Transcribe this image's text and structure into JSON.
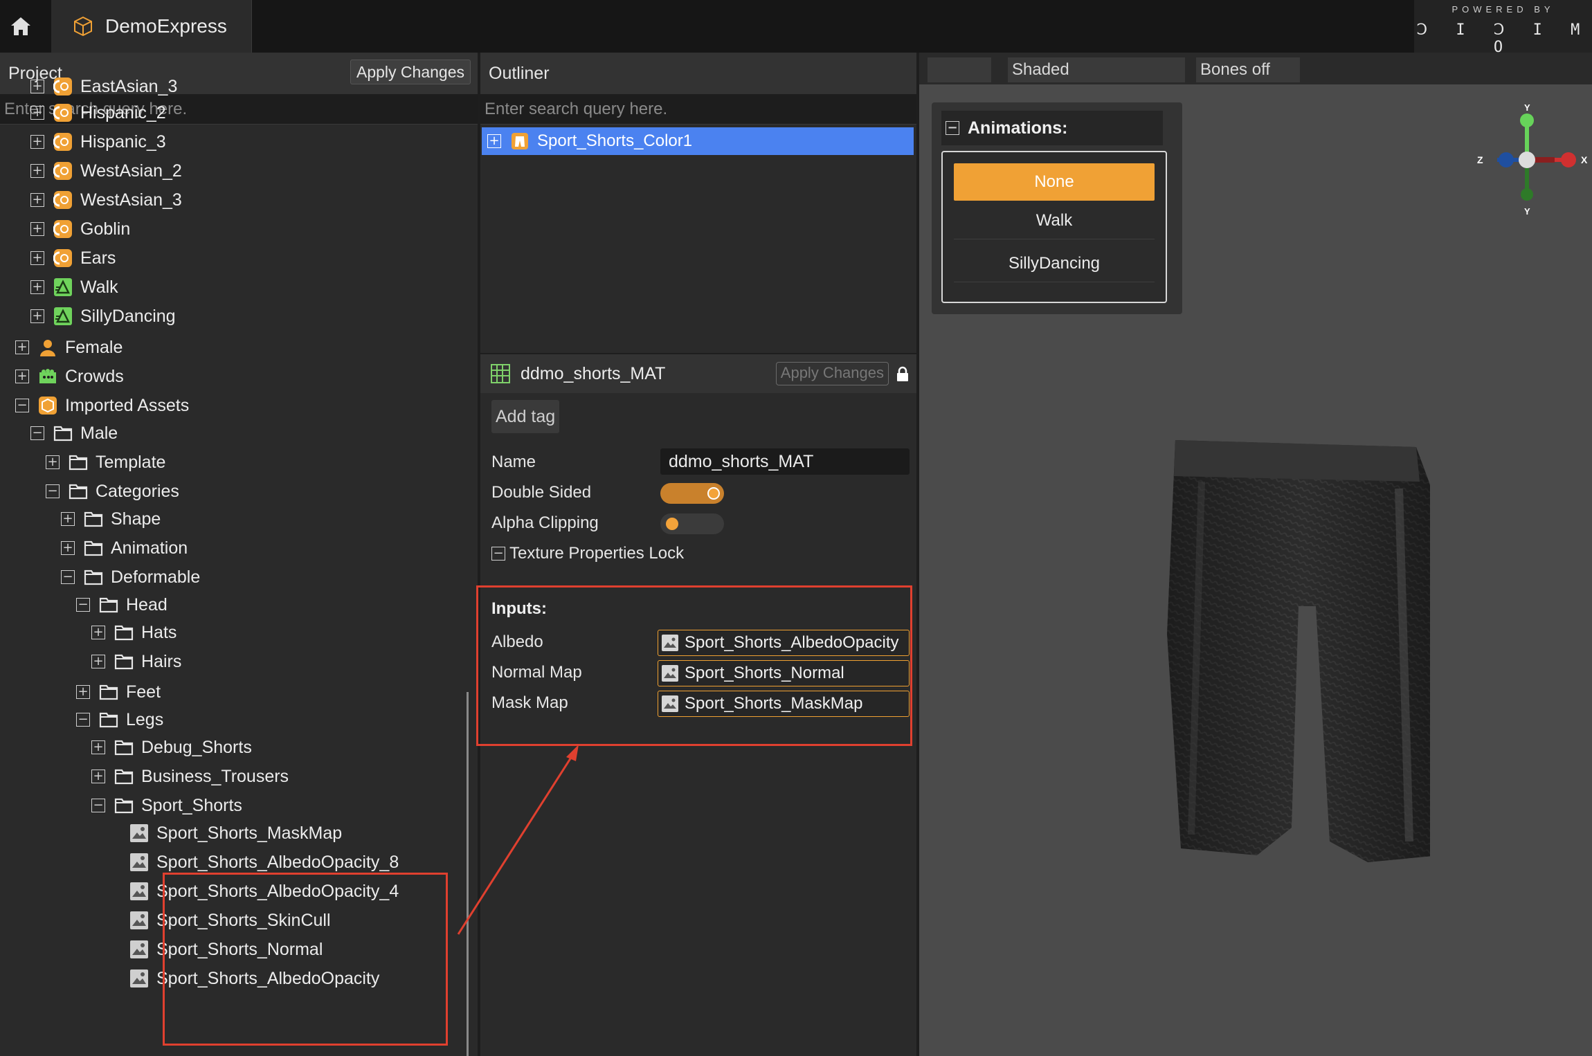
{
  "topbar": {
    "app_name": "DemoExpress",
    "powered_by": "POWERED BY",
    "brand": "DIDIMO"
  },
  "project": {
    "title": "Project",
    "apply_changes": "Apply Changes",
    "search_placeholder": "Enter search query here.",
    "tree": [
      {
        "label": "EastAsian_3",
        "icon": "face-icon",
        "expanded": false
      },
      {
        "label": "Hispanic_2",
        "icon": "face-icon",
        "expanded": false
      },
      {
        "label": "Hispanic_3",
        "icon": "face-icon",
        "expanded": false
      },
      {
        "label": "WestAsian_2",
        "icon": "face-icon",
        "expanded": false
      },
      {
        "label": "WestAsian_3",
        "icon": "face-icon",
        "expanded": false
      },
      {
        "label": "Goblin",
        "icon": "face-icon",
        "expanded": false
      },
      {
        "label": "Ears",
        "icon": "face-icon",
        "expanded": false
      },
      {
        "label": "Walk",
        "icon": "animation-icon",
        "expanded": false
      },
      {
        "label": "SillyDancing",
        "icon": "animation-icon",
        "expanded": false
      },
      {
        "label": "Female",
        "icon": "person-icon",
        "expanded": false
      },
      {
        "label": "Crowds",
        "icon": "crowd-icon",
        "expanded": false
      },
      {
        "label": "Imported Assets",
        "icon": "package-icon",
        "expanded": true
      },
      {
        "label": "Male",
        "icon": "folder-icon",
        "expanded": true
      },
      {
        "label": "Template",
        "icon": "folder-icon",
        "expanded": false
      },
      {
        "label": "Categories",
        "icon": "folder-icon",
        "expanded": true
      },
      {
        "label": "Shape",
        "icon": "folder-icon",
        "expanded": false
      },
      {
        "label": "Animation",
        "icon": "folder-icon",
        "expanded": false
      },
      {
        "label": "Deformable",
        "icon": "folder-icon",
        "expanded": true
      },
      {
        "label": "Head",
        "icon": "folder-icon",
        "expanded": true
      },
      {
        "label": "Hats",
        "icon": "folder-icon",
        "expanded": false
      },
      {
        "label": "Hairs",
        "icon": "folder-icon",
        "expanded": false
      },
      {
        "label": "Feet",
        "icon": "folder-icon",
        "expanded": false
      },
      {
        "label": "Legs",
        "icon": "folder-icon",
        "expanded": true
      },
      {
        "label": "Debug_Shorts",
        "icon": "folder-icon",
        "expanded": false
      },
      {
        "label": "Business_Trousers",
        "icon": "folder-icon",
        "expanded": false
      },
      {
        "label": "Sport_Shorts",
        "icon": "folder-icon",
        "expanded": true
      },
      {
        "label": "Sport_Shorts_MaskMap",
        "icon": "image-icon"
      },
      {
        "label": "Sport_Shorts_AlbedoOpacity_8",
        "icon": "image-icon"
      },
      {
        "label": "Sport_Shorts_AlbedoOpacity_4",
        "icon": "image-icon"
      },
      {
        "label": "Sport_Shorts_SkinCull",
        "icon": "image-icon"
      },
      {
        "label": "Sport_Shorts_Normal",
        "icon": "image-icon"
      },
      {
        "label": "Sport_Shorts_AlbedoOpacity",
        "icon": "image-icon"
      }
    ]
  },
  "outliner": {
    "title": "Outliner",
    "search_placeholder": "Enter search query here.",
    "selected_item": "Sport_Shorts_Color1"
  },
  "material": {
    "name": "ddmo_shorts_MAT",
    "apply_changes": "Apply Changes",
    "add_tag": "Add tag",
    "name_label": "Name",
    "name_value": "ddmo_shorts_MAT",
    "double_sided_label": "Double Sided",
    "double_sided": true,
    "alpha_clipping_label": "Alpha Clipping",
    "alpha_clipping": false,
    "texture_lock_label": "Texture Properties Lock",
    "inputs_title": "Inputs:",
    "inputs": [
      {
        "label": "Albedo",
        "value": "Sport_Shorts_AlbedoOpacity"
      },
      {
        "label": "Normal Map",
        "value": "Sport_Shorts_Normal"
      },
      {
        "label": "Mask Map",
        "value": "Sport_Shorts_MaskMap"
      }
    ]
  },
  "viewport": {
    "shading": "Shaded",
    "bones": "Bones off",
    "animations_title": "Animations:",
    "animations": [
      "None",
      "Walk",
      "SillyDancing"
    ],
    "selected_animation": "None",
    "gizmo": {
      "x": "X",
      "y": "Y",
      "z": "Z"
    }
  },
  "colors": {
    "accent_orange": "#f0a135",
    "selection_blue": "#4b82f0",
    "annotation_red": "#e0402f"
  }
}
